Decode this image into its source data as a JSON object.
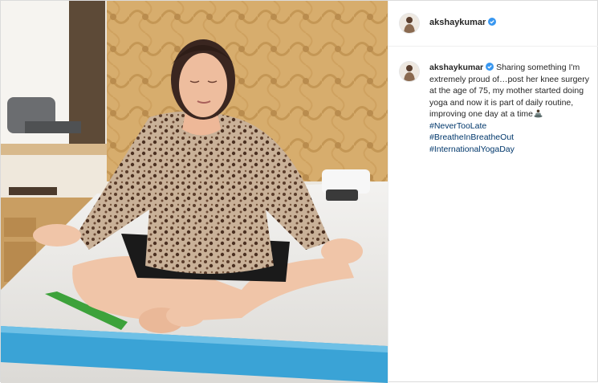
{
  "post": {
    "username": "akshaykumar",
    "verified": true,
    "caption": {
      "username": "akshaykumar",
      "text": "Sharing something I'm extremely proud of…post her knee surgery at the age of 75, my mother started doing yoga and now it is part of daily routine, improving one day at a time",
      "emoji": "person-in-lotus-position-emoji",
      "hashtags": [
        "#NeverTooLate",
        "#BreatheInBreatheOut",
        "#InternationalYogaDay"
      ]
    }
  },
  "colors": {
    "text": "#262626",
    "hashtag": "#00376b",
    "verified": "#3897f0",
    "divider": "#efefef"
  }
}
